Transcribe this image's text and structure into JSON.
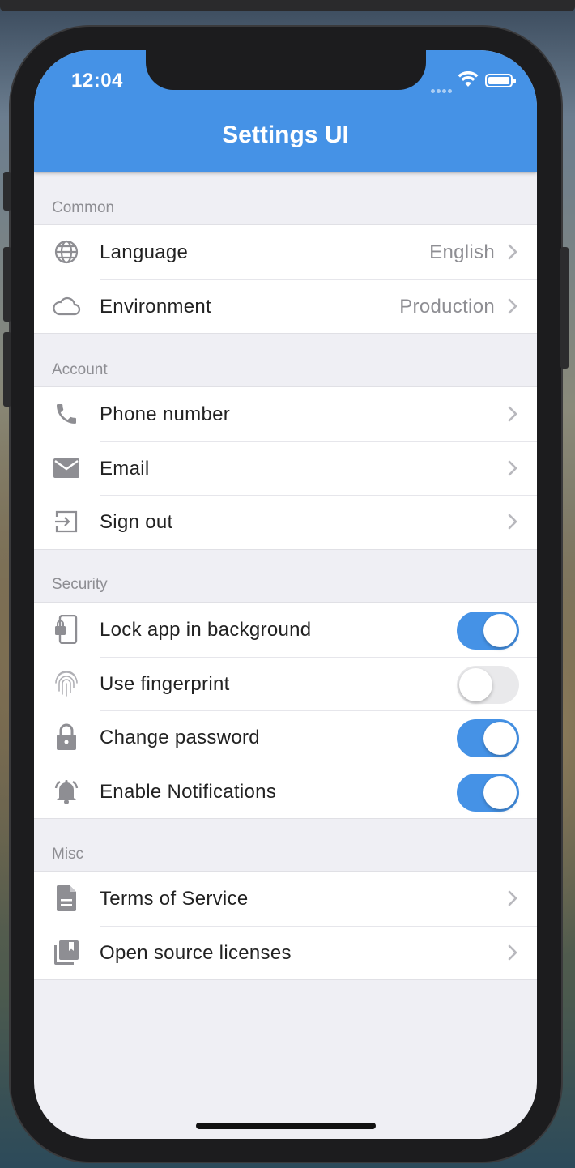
{
  "status_bar": {
    "time": "12:04"
  },
  "app": {
    "title": "Settings UI"
  },
  "colors": {
    "accent": "#4592e6",
    "background": "#efeff4",
    "icon": "#8e8e93"
  },
  "sections": [
    {
      "title": "Common",
      "rows": [
        {
          "icon": "globe-icon",
          "label": "Language",
          "value": "English",
          "type": "chevron"
        },
        {
          "icon": "cloud-icon",
          "label": "Environment",
          "value": "Production",
          "type": "chevron"
        }
      ]
    },
    {
      "title": "Account",
      "rows": [
        {
          "icon": "phone-icon",
          "label": "Phone number",
          "type": "chevron"
        },
        {
          "icon": "email-icon",
          "label": "Email",
          "type": "chevron"
        },
        {
          "icon": "sign-out-icon",
          "label": "Sign out",
          "type": "chevron"
        }
      ]
    },
    {
      "title": "Security",
      "rows": [
        {
          "icon": "phone-lock-icon",
          "label": "Lock app in background",
          "type": "toggle",
          "on": true
        },
        {
          "icon": "fingerprint-icon",
          "label": "Use fingerprint",
          "type": "toggle",
          "on": false
        },
        {
          "icon": "lock-icon",
          "label": "Change password",
          "type": "toggle",
          "on": true
        },
        {
          "icon": "bell-icon",
          "label": "Enable Notifications",
          "type": "toggle",
          "on": true
        }
      ]
    },
    {
      "title": "Misc",
      "rows": [
        {
          "icon": "document-icon",
          "label": "Terms of Service",
          "type": "chevron"
        },
        {
          "icon": "library-icon",
          "label": "Open source licenses",
          "type": "chevron"
        }
      ]
    }
  ]
}
